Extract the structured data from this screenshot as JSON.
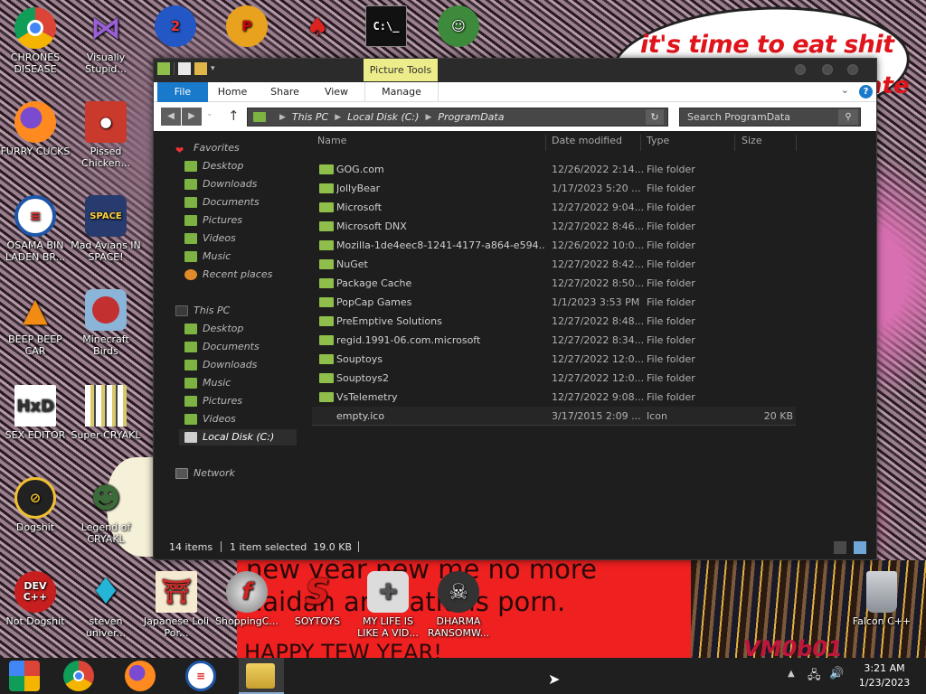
{
  "desktop": {
    "speech_text": "it's time to eat shit",
    "speech_text_2": "ate",
    "banner_text": "new year new me no more\nhaidan animations porn.",
    "banner_text_2": "HAPPY TEW YEAR!",
    "crowd_text": "VM0b01",
    "icons": [
      {
        "label": "CHRONES DISEASE",
        "icon": "chrome-icon",
        "color": "#2e7bd6"
      },
      {
        "label": "Visually Stupid...",
        "icon": "visual-studio-icon",
        "color": "#7b3fb5"
      },
      {
        "label": "FURRY CUCKS",
        "icon": "firefox-icon",
        "color": "#e66d1f"
      },
      {
        "label": "Pissed Chicken...",
        "icon": "angry-birds-seasons-icon",
        "color": "#c9392c"
      },
      {
        "label": "OSAMA BIN LADEN BR...",
        "icon": "obama-logo-icon",
        "color": "#1e57a8"
      },
      {
        "label": "Mad Avians IN SPACE!",
        "icon": "angry-birds-space-icon",
        "color": "#273b6e"
      },
      {
        "label": "BEEP BEEP CAR",
        "icon": "vlc-cone-icon",
        "color": "#f28b14"
      },
      {
        "label": "Minecraft Birds",
        "icon": "angry-bird-icon",
        "color": "#c23030"
      },
      {
        "label": "SEX EDITOR",
        "icon": "hxd-icon",
        "color": "#4a9b3a"
      },
      {
        "label": "Super CRYAKL",
        "icon": "pixel-art-icon",
        "color": "#d9c86b"
      },
      {
        "label": "Dogshit",
        "icon": "dogshit-icon",
        "color": "#222222"
      },
      {
        "label": "Legend of CRYAKL",
        "icon": "pixel-character-icon",
        "color": "#3c6b3a"
      },
      {
        "label": "Not Dogshit",
        "icon": "dev-cpp-icon",
        "color": "#c71f1f"
      },
      {
        "label": "steven univer...",
        "icon": "diamond-icon",
        "color": "#24b5d8"
      },
      {
        "label": "Japanese Loli Por...",
        "icon": "torii-icon",
        "color": "#c9302c"
      },
      {
        "label": "ShoppingC...",
        "icon": "flash-icon",
        "color": "#7a7a7a"
      },
      {
        "label": "SOYTOYS",
        "icon": "s-logo-icon",
        "color": "#d81b1b"
      },
      {
        "label": "MY LIFE IS LIKE A VID...",
        "icon": "gamepad-icon",
        "color": "#cfcfcf"
      },
      {
        "label": "DHARMA RANSOMW...",
        "icon": "skull-icon",
        "color": "#333333"
      },
      {
        "label": "Falcon C++",
        "icon": "recycle-bin-icon",
        "color": "#9aa0a6"
      }
    ]
  },
  "window": {
    "context_tab": "Picture Tools",
    "tabs": {
      "file": "File",
      "home": "Home",
      "share": "Share",
      "view": "View",
      "manage": "Manage"
    },
    "help": "?",
    "address": {
      "this_pc": "This PC",
      "drive": "Local Disk (C:)",
      "folder": "ProgramData"
    },
    "search_placeholder": "Search ProgramData",
    "nav": {
      "favorites": "Favorites",
      "fav_items": [
        "Desktop",
        "Downloads",
        "Documents",
        "Pictures",
        "Videos",
        "Music",
        "Recent places"
      ],
      "this_pc": "This PC",
      "pc_items": [
        "Desktop",
        "Documents",
        "Downloads",
        "Music",
        "Pictures",
        "Videos",
        "Local Disk (C:)"
      ],
      "network": "Network"
    },
    "columns": {
      "name": "Name",
      "date": "Date modified",
      "type": "Type",
      "size": "Size"
    },
    "files": [
      {
        "name": "GOG.com",
        "date": "12/26/2022 2:14...",
        "type": "File folder",
        "size": ""
      },
      {
        "name": "JollyBear",
        "date": "1/17/2023 5:20 ...",
        "type": "File folder",
        "size": ""
      },
      {
        "name": "Microsoft",
        "date": "12/27/2022 9:04...",
        "type": "File folder",
        "size": ""
      },
      {
        "name": "Microsoft DNX",
        "date": "12/27/2022 8:46...",
        "type": "File folder",
        "size": ""
      },
      {
        "name": "Mozilla-1de4eec8-1241-4177-a864-e594...",
        "date": "12/26/2022 10:0...",
        "type": "File folder",
        "size": ""
      },
      {
        "name": "NuGet",
        "date": "12/27/2022 8:42...",
        "type": "File folder",
        "size": ""
      },
      {
        "name": "Package Cache",
        "date": "12/27/2022 8:50...",
        "type": "File folder",
        "size": ""
      },
      {
        "name": "PopCap Games",
        "date": "1/1/2023 3:53 PM",
        "type": "File folder",
        "size": ""
      },
      {
        "name": "PreEmptive Solutions",
        "date": "12/27/2022 8:48...",
        "type": "File folder",
        "size": ""
      },
      {
        "name": "regid.1991-06.com.microsoft",
        "date": "12/27/2022 8:34...",
        "type": "File folder",
        "size": ""
      },
      {
        "name": "Souptoys",
        "date": "12/27/2022 12:0...",
        "type": "File folder",
        "size": ""
      },
      {
        "name": "Souptoys2",
        "date": "12/27/2022 12:0...",
        "type": "File folder",
        "size": ""
      },
      {
        "name": "VsTelemetry",
        "date": "12/27/2022 9:08...",
        "type": "File folder",
        "size": ""
      },
      {
        "name": "empty.ico",
        "date": "3/17/2015 2:09 ...",
        "type": "Icon",
        "size": "20 KB"
      }
    ],
    "status": {
      "items": "14 items",
      "selected": "1 item selected  19.0 KB"
    }
  },
  "taskbar": {
    "clock_time": "3:21 AM",
    "clock_date": "1/23/2023"
  }
}
